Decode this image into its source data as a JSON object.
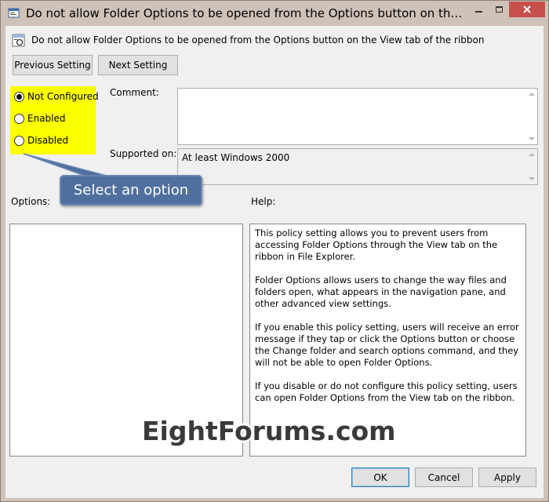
{
  "window": {
    "title": "Do not allow Folder Options to be opened from the Options button on the View ta..."
  },
  "header": {
    "title": "Do not allow Folder Options to be opened from the Options button on the View tab of the ribbon"
  },
  "nav": {
    "previous_label": "Previous Setting",
    "next_label": "Next Setting"
  },
  "state": {
    "options": [
      "Not Configured",
      "Enabled",
      "Disabled"
    ],
    "selected": "Not Configured"
  },
  "comment": {
    "label": "Comment:",
    "value": ""
  },
  "supported": {
    "label": "Supported on:",
    "value": "At least Windows 2000"
  },
  "callout": {
    "text": "Select an option"
  },
  "options_panel": {
    "label": "Options:"
  },
  "help_panel": {
    "label": "Help:",
    "paragraphs": [
      "This policy setting allows you to prevent users from accessing Folder Options through the View tab on the ribbon in File Explorer.",
      "Folder Options allows users to change the way files and folders open, what appears in the navigation pane, and other advanced view settings.",
      "If you enable this policy setting, users will receive an error message if they tap or click the Options button or choose the Change folder and search options command, and they will not be able to open Folder Options.",
      "If you disable or do not configure this policy setting, users can open Folder Options from the View tab on the ribbon."
    ]
  },
  "footer": {
    "ok_label": "OK",
    "cancel_label": "Cancel",
    "apply_label": "Apply"
  },
  "watermark": {
    "text": "EightForums.com"
  },
  "colors": {
    "highlight": "#fbff00",
    "callout": "#4f6f9e",
    "close_button": "#c7504a"
  }
}
